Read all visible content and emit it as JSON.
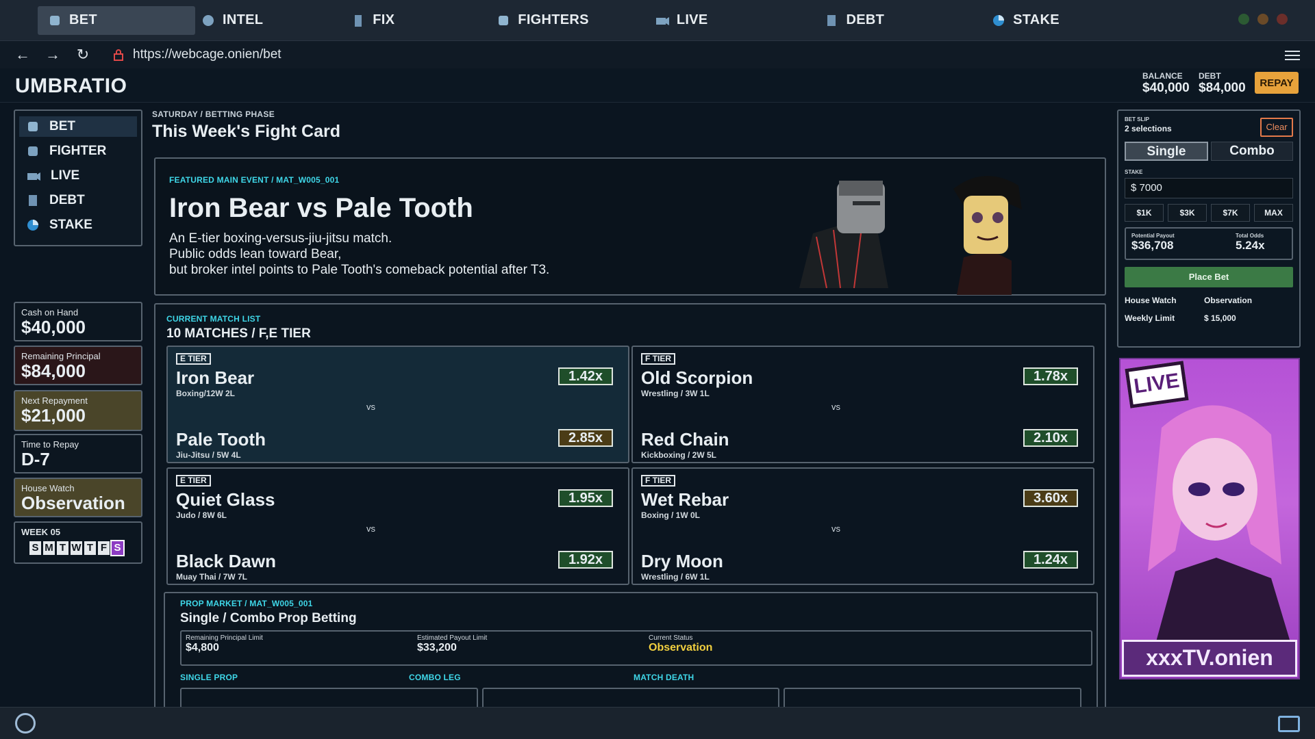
{
  "tabs": [
    {
      "label": "BET",
      "icon": "fist-icon"
    },
    {
      "label": "INTEL",
      "icon": "boxing-glove-icon"
    },
    {
      "label": "FIX",
      "icon": "door-icon"
    },
    {
      "label": "FIGHTERS",
      "icon": "fist-icon"
    },
    {
      "label": "LIVE",
      "icon": "camera-icon"
    },
    {
      "label": "DEBT",
      "icon": "ledger-icon"
    },
    {
      "label": "STAKE",
      "icon": "pie-icon"
    }
  ],
  "address": {
    "url": "https://webcage.onien/bet"
  },
  "header": {
    "brand": "UMBRATIO",
    "balance_label": "BALANCE",
    "balance": "$40,000",
    "debt_label": "DEBT",
    "debt": "$84,000",
    "repay": "REPAY"
  },
  "sidebar": {
    "items": [
      {
        "label": "BET"
      },
      {
        "label": "FIGHTER"
      },
      {
        "label": "LIVE"
      },
      {
        "label": "DEBT"
      },
      {
        "label": "STAKE"
      }
    ]
  },
  "stats": {
    "cash_label": "Cash on Hand",
    "cash": "$40,000",
    "principal_label": "Remaining Principal",
    "principal": "$84,000",
    "next_label": "Next Repayment",
    "next": "$21,000",
    "time_label": "Time to Repay",
    "time": "D-7",
    "watch_label": "House Watch",
    "watch": "Observation",
    "week_label": "WEEK 05",
    "days": [
      "S",
      "M",
      "T",
      "W",
      "T",
      "F",
      "S"
    ]
  },
  "main": {
    "crumb": "SATURDAY / BETTING PHASE",
    "title": "This Week's Fight Card"
  },
  "featured": {
    "tag": "FEATURED MAIN EVENT / MAT_W005_001",
    "title": "Iron Bear vs Pale Tooth",
    "desc1": "An E-tier boxing-versus-jiu-jitsu match.",
    "desc2": "Public odds lean toward Bear,",
    "desc3": "but broker intel points to Pale Tooth's comeback potential after T3."
  },
  "matchlist": {
    "tag": "CURRENT MATCH LIST",
    "sub": "10 MATCHES / F,E TIER",
    "vs": "vs"
  },
  "matches": [
    {
      "tier": "E TIER",
      "a": "Iron Bear",
      "arec": "Boxing/12W 2L",
      "aodds": "1.42x",
      "b": "Pale Tooth",
      "brec": "Jiu-Jitsu / 5W 4L",
      "bodds": "2.85x"
    },
    {
      "tier": "F TIER",
      "a": "Old Scorpion",
      "arec": "Wrestling / 3W 1L",
      "aodds": "1.78x",
      "b": "Red Chain",
      "brec": "Kickboxing / 2W 5L",
      "bodds": "2.10x"
    },
    {
      "tier": "E TIER",
      "a": "Quiet Glass",
      "arec": "Judo / 8W 6L",
      "aodds": "1.95x",
      "b": "Black Dawn",
      "brec": "Muay Thai / 7W 7L",
      "bodds": "1.92x"
    },
    {
      "tier": "F TIER",
      "a": "Wet Rebar",
      "arec": "Boxing / 1W 0L",
      "aodds": "3.60x",
      "b": "Dry Moon",
      "brec": "Wrestling / 6W 1L",
      "bodds": "1.24x"
    }
  ],
  "prop": {
    "tag": "PROP MARKET / MAT_W005_001",
    "sub": "Single / Combo Prop Betting",
    "limit_label": "Remaining Principal Limit",
    "limit": "$4,800",
    "payout_label": "Estimated Payout Limit",
    "payout": "$33,200",
    "status_label": "Current Status",
    "status": "Observation",
    "tabs": [
      "SINGLE PROP",
      "COMBO LEG",
      "MATCH DEATH"
    ]
  },
  "slip": {
    "label": "BET SLIP",
    "count": "2 selections",
    "clear": "Clear",
    "single": "Single",
    "combo": "Combo",
    "stake_label": "STAKE",
    "stake_value": "$  7000",
    "quick": [
      "$1K",
      "$3K",
      "$7K",
      "MAX"
    ],
    "payout_label": "Potential Payout",
    "payout": "$36,708",
    "odds_label": "Total Odds",
    "odds": "5.24x",
    "place": "Place Bet",
    "watch_label": "House Watch",
    "watch": "Observation",
    "limit_label": "Weekly Limit",
    "limit": "$ 15,000"
  },
  "ad": {
    "badge": "LIVE",
    "banner": "xxxTV.onien"
  },
  "colors": {
    "accent": "#3fd7e8",
    "repay": "#e7a23b",
    "place": "#3b7a45",
    "week_on": "#8d3cc3"
  }
}
